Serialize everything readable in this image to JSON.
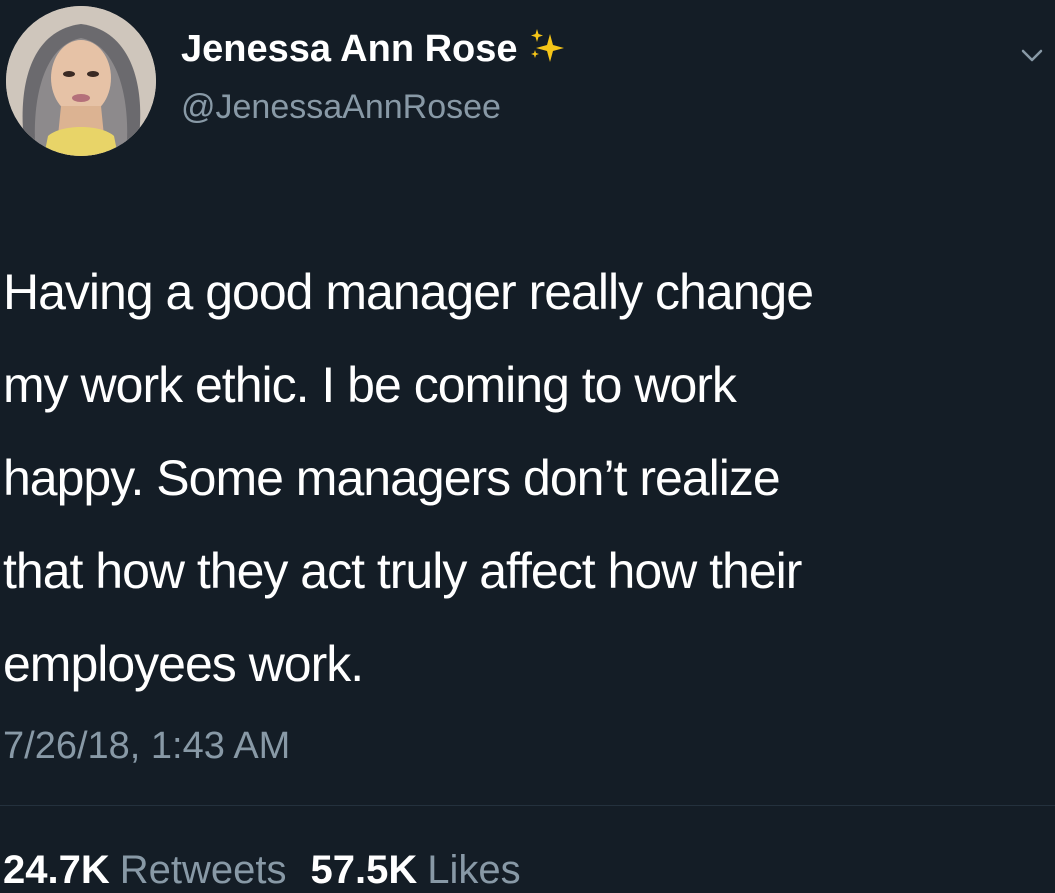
{
  "tweet": {
    "display_name": "Jenessa Ann Rose",
    "handle": "@JenessaAnnRosee",
    "text": "Having a good manager really change\nmy work ethic. I be coming to work\nhappy. Some managers don’t realize\nthat how they act truly affect how their\nemployees work.",
    "timestamp": "7/26/18, 1:43 AM",
    "retweets_count": "24.7K",
    "retweets_label": "Retweets",
    "likes_count": "57.5K",
    "likes_label": "Likes"
  },
  "icons": {
    "avatar": "profile-photo",
    "name_emoji": "sparkles-icon",
    "menu": "chevron-down-icon"
  },
  "colors": {
    "background": "#141d26",
    "primary_text": "#ffffff",
    "secondary_text": "#8899a6",
    "sparkle": "#f5c518"
  }
}
